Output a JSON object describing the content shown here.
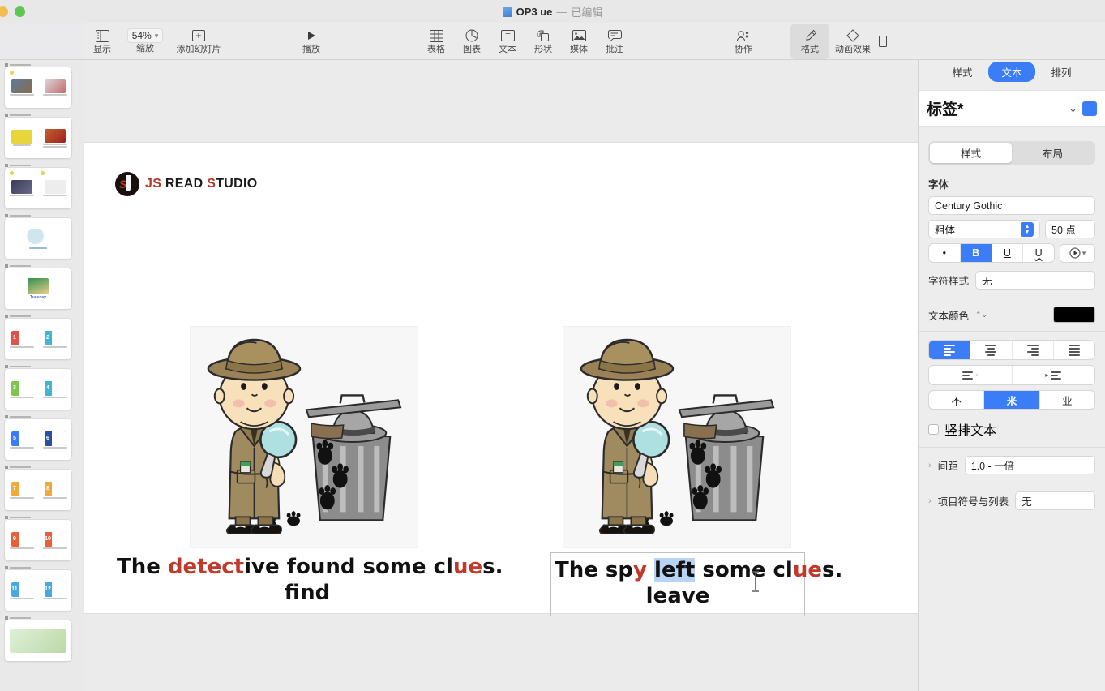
{
  "window": {
    "title_doc_name": "OP3  ue",
    "title_dash": "—",
    "title_state": "已编辑",
    "traffic_lights": [
      "yellow",
      "green"
    ]
  },
  "toolbar": {
    "items": [
      {
        "icon": "sidebar-view-icon",
        "label": "显示"
      },
      {
        "icon": "zoom-icon",
        "label": "缩放",
        "value": "54%"
      },
      {
        "icon": "add-slide-icon",
        "label": "添加幻灯片"
      },
      {
        "icon": "play-icon",
        "label": "播放"
      },
      {
        "icon": "table-icon",
        "label": "表格"
      },
      {
        "icon": "chart-icon",
        "label": "图表"
      },
      {
        "icon": "text-icon",
        "label": "文本"
      },
      {
        "icon": "shape-icon",
        "label": "形状"
      },
      {
        "icon": "media-icon",
        "label": "媒体"
      },
      {
        "icon": "comment-icon",
        "label": "批注"
      },
      {
        "icon": "collaborate-icon",
        "label": "协作"
      },
      {
        "icon": "format-brush-icon",
        "label": "格式"
      },
      {
        "icon": "animate-icon",
        "label": "动画效果"
      }
    ]
  },
  "navigator": {
    "slides": [
      {
        "type": "photo-pair",
        "dot": true
      },
      {
        "type": "photo-pair",
        "dot": false
      },
      {
        "type": "photo-pair",
        "dot": true
      },
      {
        "type": "single-magnifier",
        "dot": false
      },
      {
        "type": "single-note",
        "caption": "Tuesday",
        "dot": false
      },
      {
        "type": "calendar-pair",
        "nums": [
          "1",
          "2"
        ],
        "colors": [
          "#e0514c",
          "#3fb6d6"
        ]
      },
      {
        "type": "calendar-pair",
        "nums": [
          "3",
          "4"
        ],
        "colors": [
          "#7ec44f",
          "#3fb6d6"
        ]
      },
      {
        "type": "calendar-pair",
        "nums": [
          "5",
          "6"
        ],
        "colors": [
          "#3b7df6",
          "#2b4fa0"
        ]
      },
      {
        "type": "calendar-pair",
        "nums": [
          "7",
          "8"
        ],
        "colors": [
          "#f0a93c",
          "#f0a93c"
        ]
      },
      {
        "type": "calendar-pair",
        "nums": [
          "9",
          "10"
        ],
        "colors": [
          "#e8603a",
          "#e8603a"
        ]
      },
      {
        "type": "calendar-pair",
        "nums": [
          "11",
          "12"
        ],
        "colors": [
          "#4aa8e0",
          "#4aa8e0"
        ]
      },
      {
        "type": "map-slide",
        "dot": false
      }
    ]
  },
  "slide": {
    "logo": {
      "prefix": "JS",
      "mid": " READ ",
      "accent": "S",
      "suffix": "TUDIO",
      "full": "JS READ STUDIO"
    },
    "left_card": {
      "image_alt": "detective-boy-with-magnifier-and-trashcan",
      "line1_parts": [
        {
          "text": "The ",
          "style": "plain"
        },
        {
          "text": "detect",
          "style": "red"
        },
        {
          "text": "ive found some cl",
          "style": "plain"
        },
        {
          "text": "ue",
          "style": "red"
        },
        {
          "text": "s.",
          "style": "plain"
        }
      ],
      "line2": "find"
    },
    "right_card": {
      "image_alt": "detective-boy-with-magnifier-and-trashcan",
      "line1_parts": [
        {
          "text": "The sp",
          "style": "plain"
        },
        {
          "text": "y",
          "style": "red"
        },
        {
          "text": " ",
          "style": "plain"
        },
        {
          "text": "left",
          "style": "selected"
        },
        {
          "text": " some cl",
          "style": "plain"
        },
        {
          "text": "ue",
          "style": "red"
        },
        {
          "text": "s.",
          "style": "plain"
        }
      ],
      "line2": "leave"
    }
  },
  "inspector": {
    "tabs": [
      {
        "label": "样式",
        "active": false
      },
      {
        "label": "文本",
        "active": true
      },
      {
        "label": "排列",
        "active": false
      }
    ],
    "object_title": "标签*",
    "sub_tabs": [
      {
        "label": "样式",
        "active": true
      },
      {
        "label": "布局",
        "active": false
      }
    ],
    "font_section_label": "字体",
    "font_family": "Century Gothic",
    "font_weight": "粗体",
    "font_size": "50 点",
    "style_buttons": [
      {
        "name": "bullet",
        "label": "•",
        "active": false
      },
      {
        "name": "bold",
        "label": "B",
        "active": true
      },
      {
        "name": "underline",
        "label": "U",
        "active": false
      },
      {
        "name": "underline-wavy",
        "label": "U",
        "active": false
      }
    ],
    "char_style_label": "字符样式",
    "char_style_value": "无",
    "text_color_label": "文本颜色",
    "text_color_value": "#000000",
    "align_buttons": [
      "align-left",
      "align-center",
      "align-right",
      "align-justify"
    ],
    "align_active_index": 0,
    "indent_buttons": [
      "decrease-indent",
      "increase-indent"
    ],
    "vertical_align": [
      {
        "label": "不",
        "name": "v-align-top",
        "active": false
      },
      {
        "label": "米",
        "name": "v-align-middle",
        "active": true
      },
      {
        "label": "业",
        "name": "v-align-bottom",
        "active": false
      }
    ],
    "vertical_text_label": "竖排文本",
    "vertical_text_checked": false,
    "spacing_label": "间距",
    "spacing_value": "1.0 - 一倍",
    "bullets_label": "项目符号与列表",
    "bullets_value": "无",
    "accent_color": "#3b7df6"
  }
}
